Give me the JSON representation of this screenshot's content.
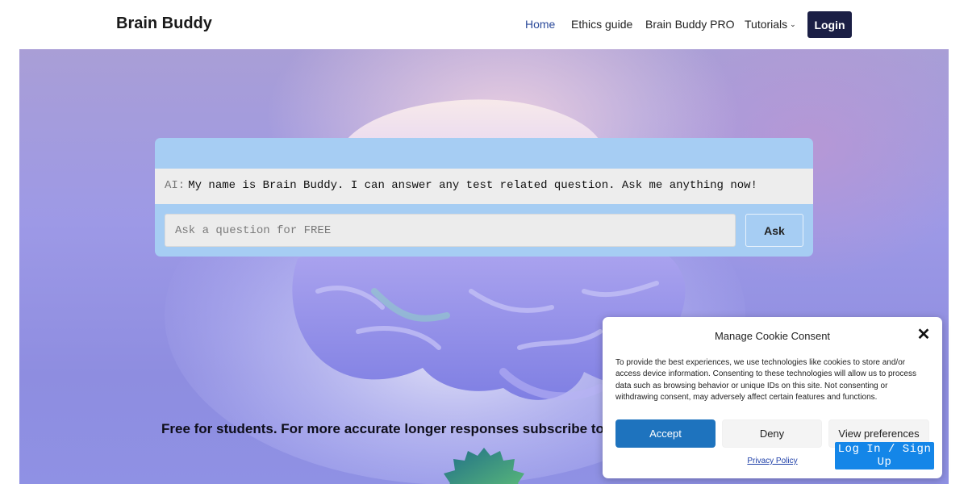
{
  "header": {
    "logo": "Brain Buddy",
    "nav": [
      {
        "label": "Home",
        "active": true
      },
      {
        "label": "Ethics guide"
      },
      {
        "label": "Brain Buddy PRO"
      },
      {
        "label": "Tutorials",
        "has_dropdown": true
      }
    ],
    "login_label": "Login"
  },
  "chat": {
    "ai_prefix": "AI:",
    "ai_message": "My name is Brain Buddy. I can answer any test related question. Ask me anything now!",
    "input_placeholder": "Ask a question for FREE",
    "input_value": "",
    "ask_label": "Ask"
  },
  "promo_text": "Free for students. For more accurate longer responses subscribe to Brain Buddy PRO",
  "cookie": {
    "title": "Manage Cookie Consent",
    "body": "To provide the best experiences, we use technologies like cookies to store and/or access device information. Consenting to these technologies will allow us to process data such as browsing behavior or unique IDs on this site. Not consenting or withdrawing consent, may adversely affect certain features and functions.",
    "accept_label": "Accept",
    "deny_label": "Deny",
    "prefs_label": "View preferences",
    "privacy_label": "Privacy Policy"
  },
  "signup_label": "Log In / Sign Up",
  "icons": {
    "close": "close-icon",
    "dropdown": "chevron-down-icon",
    "badge": "starburst-badge-icon"
  },
  "colors": {
    "login_bg": "#1b1f45",
    "nav_active": "#2b4a9a",
    "chat_panel": "#a6cdf3",
    "accept": "#1e73be",
    "signup": "#1486e8"
  }
}
